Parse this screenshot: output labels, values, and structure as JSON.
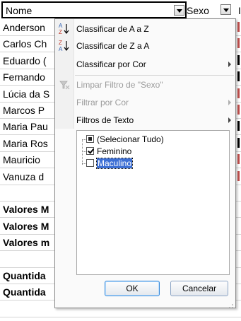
{
  "sheet": {
    "header_col1": "Nome",
    "header_col2": "Sexo",
    "header_col3": "I",
    "rows": [
      {
        "name": "Anderson",
        "bold": false,
        "mark_color": "#c0504d"
      },
      {
        "name": "Carlos Ch",
        "bold": false,
        "mark_color": "#c0504d"
      },
      {
        "name": "Eduardo (",
        "bold": false,
        "mark_color": "#000000"
      },
      {
        "name": "Fernando",
        "bold": false,
        "mark_color": "#000000"
      },
      {
        "name": "Lúcia da S",
        "bold": false,
        "mark_color": "#c0504d"
      },
      {
        "name": "Marcos P",
        "bold": false,
        "mark_color": "#c0504d"
      },
      {
        "name": "Maria Pau",
        "bold": false,
        "mark_color": "#000000"
      },
      {
        "name": "Maria Ros",
        "bold": false,
        "mark_color": "#000000"
      },
      {
        "name": "Mauricio",
        "bold": false,
        "mark_color": "#c0504d"
      },
      {
        "name": "Vanuza d",
        "bold": false,
        "mark_color": "#c0504d"
      },
      {
        "name": "",
        "bold": false,
        "mark_color": ""
      },
      {
        "name": "Valores M",
        "bold": true,
        "mark_color": ""
      },
      {
        "name": "Valores M",
        "bold": true,
        "mark_color": ""
      },
      {
        "name": "Valores m",
        "bold": true,
        "mark_color": ""
      },
      {
        "name": "",
        "bold": false,
        "mark_color": ""
      },
      {
        "name": "Quantida",
        "bold": true,
        "mark_color": ""
      },
      {
        "name": "Quantida",
        "bold": true,
        "mark_color": ""
      },
      {
        "name": "",
        "bold": false,
        "mark_color": ""
      }
    ]
  },
  "menu": {
    "sort_az": "Classificar de A a Z",
    "sort_za": "Classificar de Z a A",
    "sort_by_color": "Classificar por Cor",
    "clear_filter": "Limpar Filtro de \"Sexo\"",
    "filter_by_color": "Filtrar por Cor",
    "text_filters": "Filtros de Texto"
  },
  "tree": {
    "select_all": "(Selecionar Tudo)",
    "items": [
      "Feminino",
      "Maculino"
    ]
  },
  "buttons": {
    "ok": "OK",
    "cancel": "Cancelar"
  },
  "colors": {
    "selection": "#3d6fd4",
    "sort_icon_red": "#c0392b",
    "sort_icon_blue": "#2a5db0"
  }
}
